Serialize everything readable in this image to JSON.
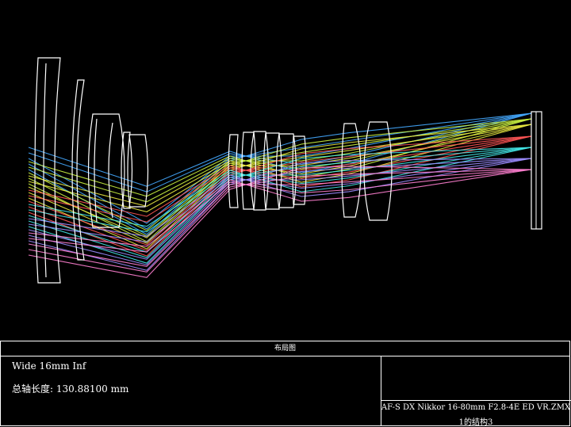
{
  "panel": {
    "title": "布局图",
    "config": "Wide 16mm Inf",
    "axial_length_label": "总轴长度:",
    "axial_length_value": "130.88100 mm",
    "file_name": "AF-S DX Nikkor 16-80mm F2.8-4E ED VR.ZMX",
    "config_label": "1的结构3"
  },
  "colors": {
    "background": "#000000",
    "lens_outline": "#ffffff",
    "rays": [
      "#44a8ff",
      "#c8f040",
      "#e8e840",
      "#ff5555",
      "#44e8e8",
      "#9b8cff",
      "#ff80d0"
    ]
  }
}
